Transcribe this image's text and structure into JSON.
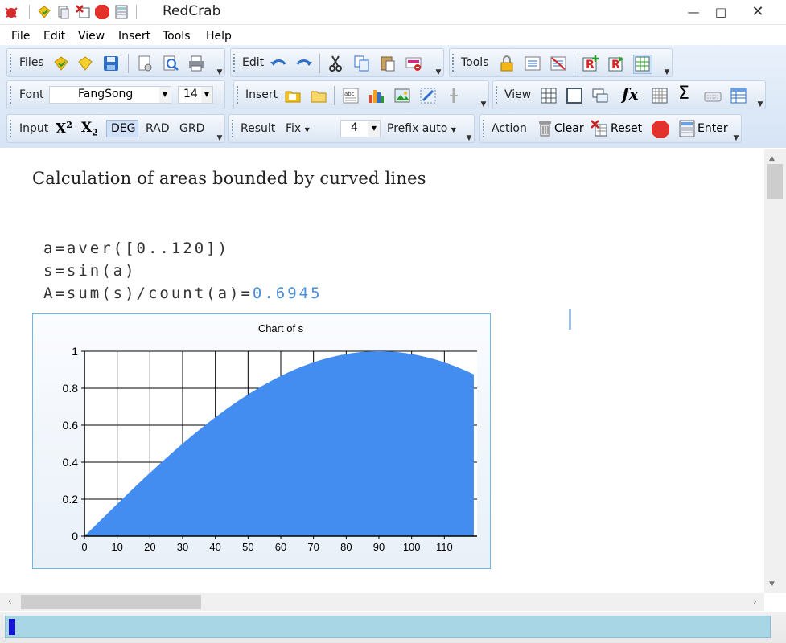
{
  "window": {
    "title": "RedCrab"
  },
  "menu": [
    "File",
    "Edit",
    "View",
    "Insert",
    "Tools",
    "Help"
  ],
  "toolbars": {
    "files_label": "Files",
    "edit_label": "Edit",
    "tools_label": "Tools",
    "font_label": "Font",
    "font_name": "FangSong",
    "font_size": "14",
    "insert_label": "Insert",
    "view_label": "View",
    "input_label": "Input",
    "superscript": "X",
    "superscript_exp": "2",
    "subscript": "X",
    "subscript_exp": "2",
    "deg": "DEG",
    "rad": "RAD",
    "grd": "GRD",
    "result_label": "Result",
    "fix_label": "Fix",
    "digits": "4",
    "prefix": "Prefix auto",
    "action_label": "Action",
    "clear": "Clear",
    "reset": "Reset",
    "enter": "Enter",
    "fx": "fx",
    "sigma": "Σ"
  },
  "document": {
    "heading": "Calculation of areas bounded by curved lines",
    "line1": "a=aver([0..120])",
    "line2": "s=sin(a)",
    "line3_prefix": "A=sum(s)/count(a)=",
    "line3_result": "0.6945"
  },
  "chart_data": {
    "type": "area",
    "title": "Chart of s",
    "xlabel": "",
    "ylabel": "",
    "xlim": [
      0,
      120
    ],
    "ylim": [
      0,
      1
    ],
    "xticks": [
      0,
      10,
      20,
      30,
      40,
      50,
      60,
      70,
      80,
      90,
      100,
      110
    ],
    "yticks": [
      0,
      0.2,
      0.4,
      0.6,
      0.8,
      1
    ],
    "grid": true,
    "series": [
      {
        "function": "sin(x°)",
        "x_range": [
          0,
          119
        ],
        "color": "#438cf0"
      }
    ]
  }
}
